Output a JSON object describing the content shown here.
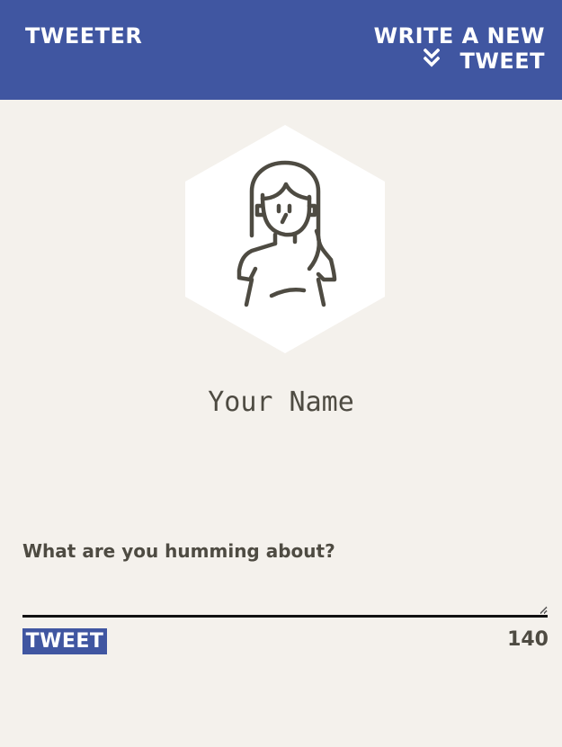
{
  "nav": {
    "brand": "TWEETER",
    "compose_label": "WRITE A NEW TWEET",
    "compose_icon": "double-chevron-down-icon"
  },
  "profile": {
    "avatar_icon": "person-avatar-icon",
    "name": "Your Name"
  },
  "composer": {
    "prompt": "What are you humming about?",
    "input_value": "",
    "submit_label": "TWEET",
    "counter": "140"
  },
  "colors": {
    "accent": "#4056a1",
    "background": "#f4f1ec",
    "text": "#4e4b42"
  }
}
